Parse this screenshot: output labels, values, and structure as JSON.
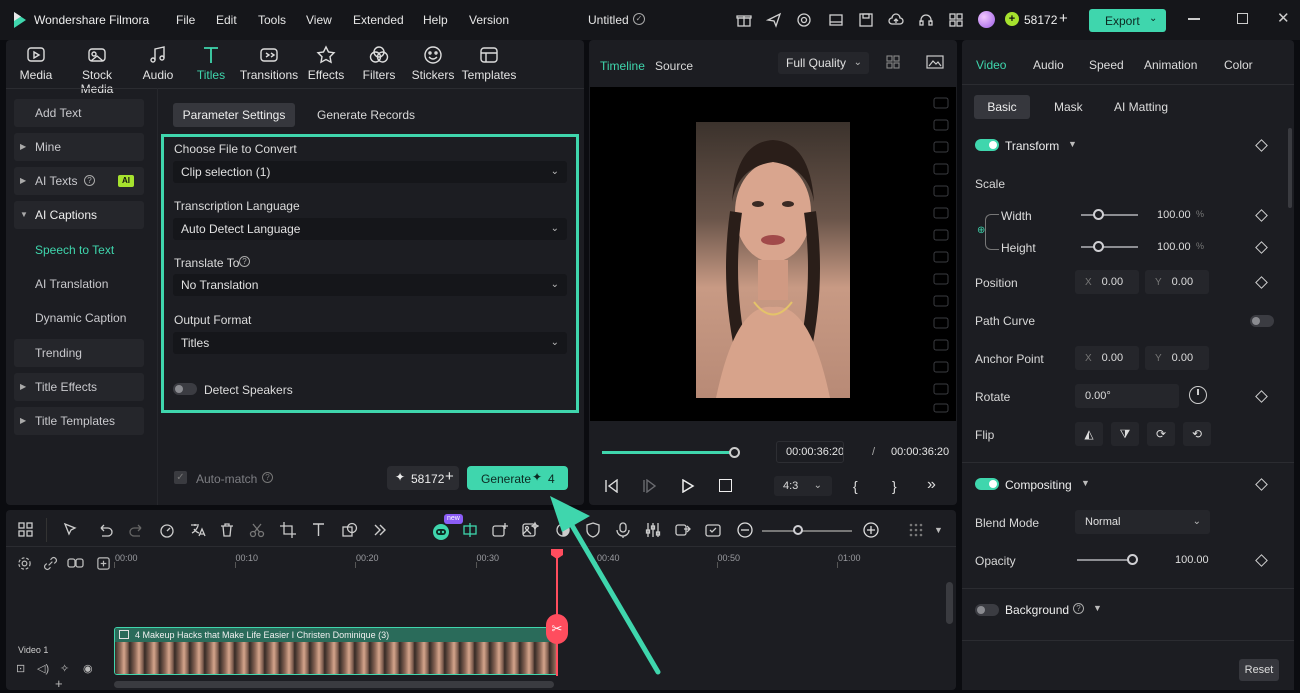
{
  "app": {
    "name": "Wondershare Filmora",
    "project_title": "Untitled"
  },
  "menu": [
    "File",
    "Edit",
    "Tools",
    "View",
    "Extended",
    "Help",
    "Version"
  ],
  "credits": "58172",
  "export_label": "Export",
  "media_tabs": [
    "Media",
    "Stock Media",
    "Audio",
    "Titles",
    "Transitions",
    "Effects",
    "Filters",
    "Stickers",
    "Templates"
  ],
  "active_media_tab": "Titles",
  "sidebar": {
    "add_text": "Add Text",
    "mine": "Mine",
    "ai_texts": "AI Texts",
    "ai_badge": "AI",
    "ai_captions": "AI Captions",
    "speech_to_text": "Speech to Text",
    "ai_translation": "AI Translation",
    "dynamic_caption": "Dynamic Caption",
    "trending": "Trending",
    "title_effects": "Title Effects",
    "title_templates": "Title Templates"
  },
  "stt": {
    "tab_params": "Parameter Settings",
    "tab_records": "Generate Records",
    "file_label": "Choose File to Convert",
    "file_value": "Clip selection (1)",
    "lang_label": "Transcription Language",
    "lang_value": "Auto Detect Language",
    "translate_label": "Translate To",
    "translate_value": "No Translation",
    "format_label": "Output Format",
    "format_value": "Titles",
    "detect_speakers": "Detect Speakers",
    "auto_match": "Auto-match",
    "credits": "58172",
    "generate": "Generate",
    "generate_cost": "4"
  },
  "player": {
    "tab_timeline": "Timeline",
    "tab_source": "Source",
    "quality": "Full Quality",
    "current_time": "00:00:36:20",
    "separator": "/",
    "total_time": "00:00:36:20",
    "aspect": "4:3",
    "progress": 1.0
  },
  "props": {
    "tabs": [
      "Video",
      "Audio",
      "Speed",
      "Animation",
      "Color"
    ],
    "subtabs": [
      "Basic",
      "Mask",
      "AI Matting"
    ],
    "transform": "Transform",
    "scale": "Scale",
    "width": "Width",
    "width_val": "100.00",
    "height": "Height",
    "height_val": "100.00",
    "pct": "%",
    "position": "Position",
    "pos_x": "0.00",
    "pos_y": "0.00",
    "x": "X",
    "y": "Y",
    "path_curve": "Path Curve",
    "anchor_point": "Anchor Point",
    "anchor_x": "0.00",
    "anchor_y": "0.00",
    "rotate": "Rotate",
    "rotate_val": "0.00°",
    "flip": "Flip",
    "compositing": "Compositing",
    "blend_mode": "Blend Mode",
    "blend_value": "Normal",
    "opacity": "Opacity",
    "opacity_val": "100.00",
    "background": "Background",
    "reset": "Reset"
  },
  "timeline": {
    "ticks": [
      "00:00",
      "00:10",
      "00:20",
      "00:30",
      "00:40",
      "00:50",
      "01:00"
    ],
    "track_label": "Video 1",
    "clip_title": "4 Makeup Hacks that Make Life Easier I Christen Dominique (3)",
    "new_badge": "new"
  },
  "colors": {
    "accent": "#3fd6ad",
    "playhead": "#ff4d5e",
    "panel": "#1c1d22"
  }
}
